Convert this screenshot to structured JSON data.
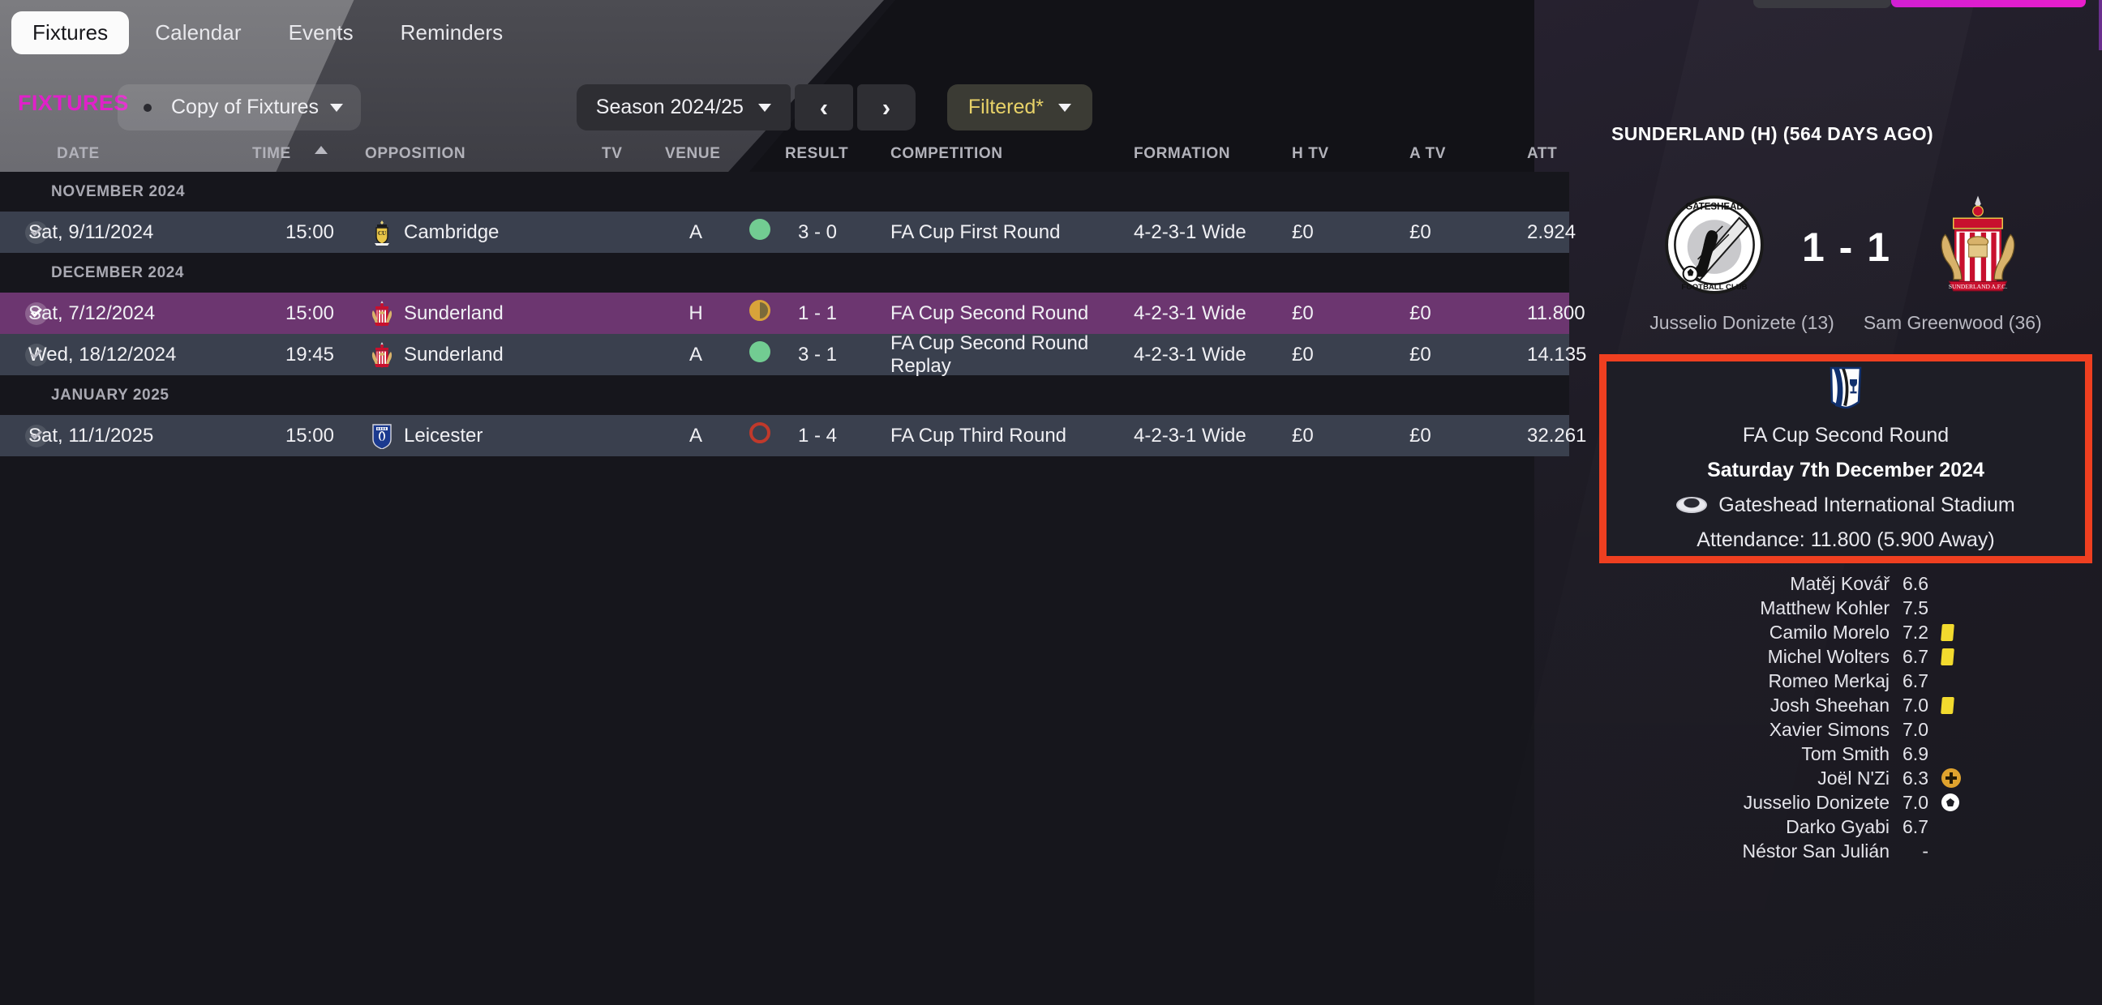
{
  "tabs": [
    {
      "label": "Fixtures",
      "active": true
    },
    {
      "label": "Calendar",
      "active": false
    },
    {
      "label": "Events",
      "active": false
    },
    {
      "label": "Reminders",
      "active": false
    }
  ],
  "toolbar": {
    "section_title": "FIXTURES",
    "view_label": "Copy of Fixtures",
    "view_icon": "eye-icon",
    "season_label": "Season 2024/25",
    "prev_label": "‹",
    "next_label": "›",
    "filter_label": "Filtered*",
    "filter_color": "#e8d268",
    "accent_color": "#e021c9"
  },
  "table": {
    "columns": [
      "DATE",
      "TIME",
      "OPPOSITION",
      "TV",
      "VENUE",
      "RESULT",
      "COMPETITION",
      "FORMATION",
      "H TV",
      "A TV",
      "ATT"
    ],
    "sort_column": "DATE",
    "sort_direction": "ascending",
    "groups": [
      {
        "month": "NOVEMBER 2024",
        "rows": [
          {
            "date": "Sat, 9/11/2024",
            "time": "15:00",
            "opposition": "Cambridge",
            "crest": "cambridge-crest",
            "tv": "",
            "venue": "A",
            "outcome": "win",
            "result": "3 - 0",
            "competition": "FA Cup First Round",
            "formation": "4-2-3-1 Wide",
            "h_tv": "£0",
            "a_tv": "£0",
            "att": "2.924",
            "selected": false
          }
        ]
      },
      {
        "month": "DECEMBER 2024",
        "rows": [
          {
            "date": "Sat, 7/12/2024",
            "time": "15:00",
            "opposition": "Sunderland",
            "crest": "sunderland-crest",
            "tv": "",
            "venue": "H",
            "outcome": "draw",
            "result": "1 - 1",
            "competition": "FA Cup Second Round",
            "formation": "4-2-3-1 Wide",
            "h_tv": "£0",
            "a_tv": "£0",
            "att": "11.800",
            "selected": true
          },
          {
            "date": "Wed, 18/12/2024",
            "time": "19:45",
            "opposition": "Sunderland",
            "crest": "sunderland-crest",
            "tv": "",
            "venue": "A",
            "outcome": "win",
            "result": "3 - 1",
            "competition": "FA Cup Second Round Replay",
            "formation": "4-2-3-1 Wide",
            "h_tv": "£0",
            "a_tv": "£0",
            "att": "14.135",
            "selected": false
          }
        ]
      },
      {
        "month": "JANUARY 2025",
        "rows": [
          {
            "date": "Sat, 11/1/2025",
            "time": "15:00",
            "opposition": "Leicester",
            "crest": "leicester-crest",
            "tv": "",
            "venue": "A",
            "outcome": "loss",
            "result": "1 - 4",
            "competition": "FA Cup Third Round",
            "formation": "4-2-3-1 Wide",
            "h_tv": "£0",
            "a_tv": "£0",
            "att": "32.261",
            "selected": false
          }
        ]
      }
    ]
  },
  "panel": {
    "title": "SUNDERLAND (H) (564 DAYS AGO)",
    "home_crest": "gateshead-crest",
    "away_crest": "sunderland-crest",
    "score": "1 - 1",
    "home_scorer": "Jusselio Donizete (13)",
    "away_scorer": "Sam Greenwood (36)",
    "highlight_color": "#ef3f20",
    "info": {
      "competition_icon": "fa-cup-icon",
      "competition": "FA Cup Second Round",
      "date": "Saturday 7th December 2024",
      "stadium_icon": "stadium-icon",
      "stadium": "Gateshead International Stadium",
      "attendance": "Attendance: 11.800 (5.900 Away)"
    },
    "ratings": [
      {
        "name": "Matěj Kovář",
        "rating": "6.6",
        "icon": ""
      },
      {
        "name": "Matthew Kohler",
        "rating": "7.5",
        "icon": ""
      },
      {
        "name": "Camilo Morelo",
        "rating": "7.2",
        "icon": "yellow-card"
      },
      {
        "name": "Michel Wolters",
        "rating": "6.7",
        "icon": "yellow-card"
      },
      {
        "name": "Romeo Merkaj",
        "rating": "6.7",
        "icon": ""
      },
      {
        "name": "Josh Sheehan",
        "rating": "7.0",
        "icon": "yellow-card"
      },
      {
        "name": "Xavier Simons",
        "rating": "7.0",
        "icon": ""
      },
      {
        "name": "Tom Smith",
        "rating": "6.9",
        "icon": ""
      },
      {
        "name": "Joël N'Zi",
        "rating": "6.3",
        "icon": "plus"
      },
      {
        "name": "Jusselio Donizete",
        "rating": "7.0",
        "icon": "goal"
      },
      {
        "name": "Darko Gyabi",
        "rating": "6.7",
        "icon": ""
      },
      {
        "name": "Néstor San Julián",
        "rating": "-",
        "icon": ""
      }
    ]
  }
}
